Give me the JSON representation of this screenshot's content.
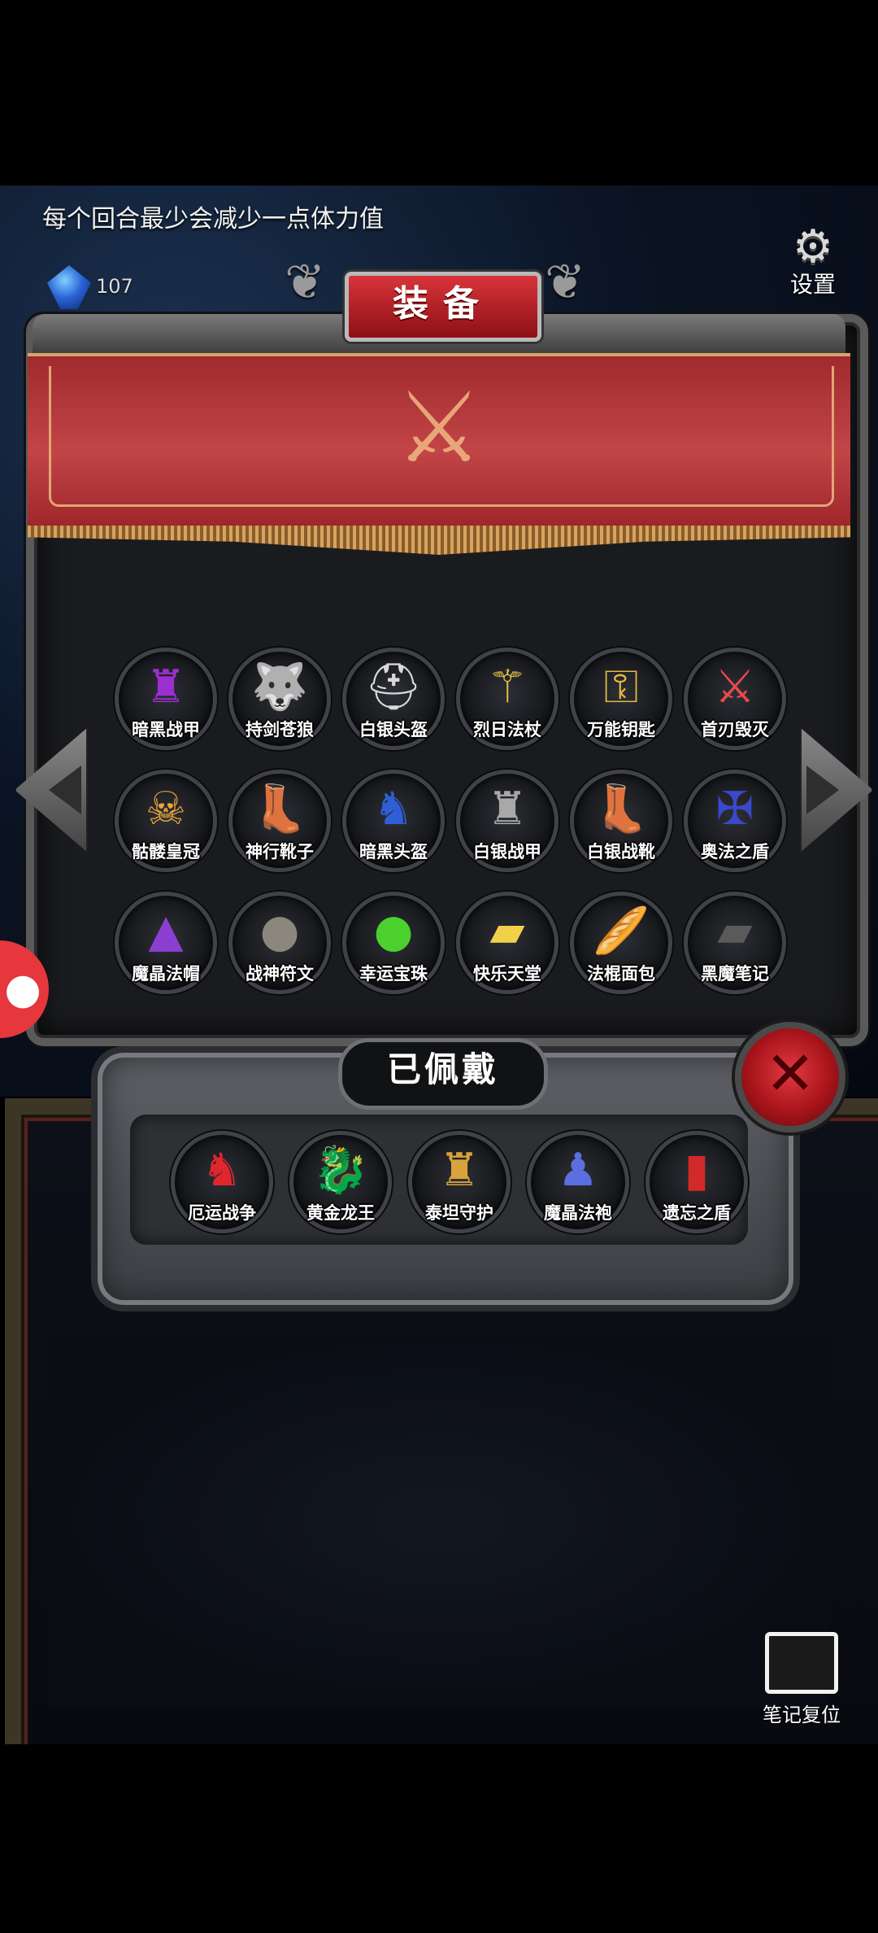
{
  "hud": {
    "tip": "每个回合最少会减少一点体力值",
    "crystal_count": "107",
    "settings_label": "设置"
  },
  "equipment_panel": {
    "title": "装备",
    "items": [
      {
        "label": "暗黑战甲",
        "icon": "dark-armor-icon",
        "glyph": "♜",
        "color": "#9b2fd1"
      },
      {
        "label": "持剑苍狼",
        "icon": "sword-wolf-icon",
        "glyph": "🐺",
        "color": "#8fa3c7"
      },
      {
        "label": "白银头盔",
        "icon": "silver-helmet-icon",
        "glyph": "⛑",
        "color": "#d9d9d9"
      },
      {
        "label": "烈日法杖",
        "icon": "sun-staff-icon",
        "glyph": "⚚",
        "color": "#e8c14a"
      },
      {
        "label": "万能钥匙",
        "icon": "master-key-icon",
        "glyph": "⚿",
        "color": "#e6b642"
      },
      {
        "label": "首刃毁灭",
        "icon": "blade-destruction-icon",
        "glyph": "⚔",
        "color": "#e94a4a"
      },
      {
        "label": "骷髅皇冠",
        "icon": "skull-crown-icon",
        "glyph": "☠",
        "color": "#e8a33a"
      },
      {
        "label": "神行靴子",
        "icon": "swift-boots-icon",
        "glyph": "👢",
        "color": "#b8862e"
      },
      {
        "label": "暗黑头盔",
        "icon": "dark-helmet-icon",
        "glyph": "♞",
        "color": "#2f5fd6"
      },
      {
        "label": "白银战甲",
        "icon": "silver-armor-icon",
        "glyph": "♜",
        "color": "#a8a8a8"
      },
      {
        "label": "白银战靴",
        "icon": "silver-boots-icon",
        "glyph": "👢",
        "color": "#c7c7c7"
      },
      {
        "label": "奥法之盾",
        "icon": "arcane-shield-icon",
        "glyph": "✠",
        "color": "#3a48c9"
      },
      {
        "label": "魔晶法帽",
        "icon": "crystal-hat-icon",
        "glyph": "▲",
        "color": "#8a3fd1"
      },
      {
        "label": "战神符文",
        "icon": "war-rune-icon",
        "glyph": "●",
        "color": "#8c877c"
      },
      {
        "label": "幸运宝珠",
        "icon": "lucky-orb-icon",
        "glyph": "●",
        "color": "#4bd02d"
      },
      {
        "label": "快乐天堂",
        "icon": "happy-heaven-book-icon",
        "glyph": "▰",
        "color": "#f2d14a"
      },
      {
        "label": "法棍面包",
        "icon": "baguette-icon",
        "glyph": "🥖",
        "color": "#d9812e"
      },
      {
        "label": "黑魔笔记",
        "icon": "dark-notebook-icon",
        "glyph": "▰",
        "color": "#5a5a5a"
      }
    ]
  },
  "equipped_panel": {
    "title": "已佩戴",
    "items": [
      {
        "label": "厄运战争",
        "icon": "doom-war-icon",
        "glyph": "♞",
        "color": "#e0262e"
      },
      {
        "label": "黄金龙王",
        "icon": "golden-dragon-icon",
        "glyph": "🐉",
        "color": "#e8a12a"
      },
      {
        "label": "泰坦守护",
        "icon": "titan-guard-icon",
        "glyph": "♜",
        "color": "#d9a23a"
      },
      {
        "label": "魔晶法袍",
        "icon": "crystal-robe-icon",
        "glyph": "♟",
        "color": "#5b6fe0"
      },
      {
        "label": "遗忘之盾",
        "icon": "forgotten-shield-icon",
        "glyph": "▮",
        "color": "#d22a2a"
      }
    ]
  },
  "bottom": {
    "reset_label": "笔记复位"
  }
}
